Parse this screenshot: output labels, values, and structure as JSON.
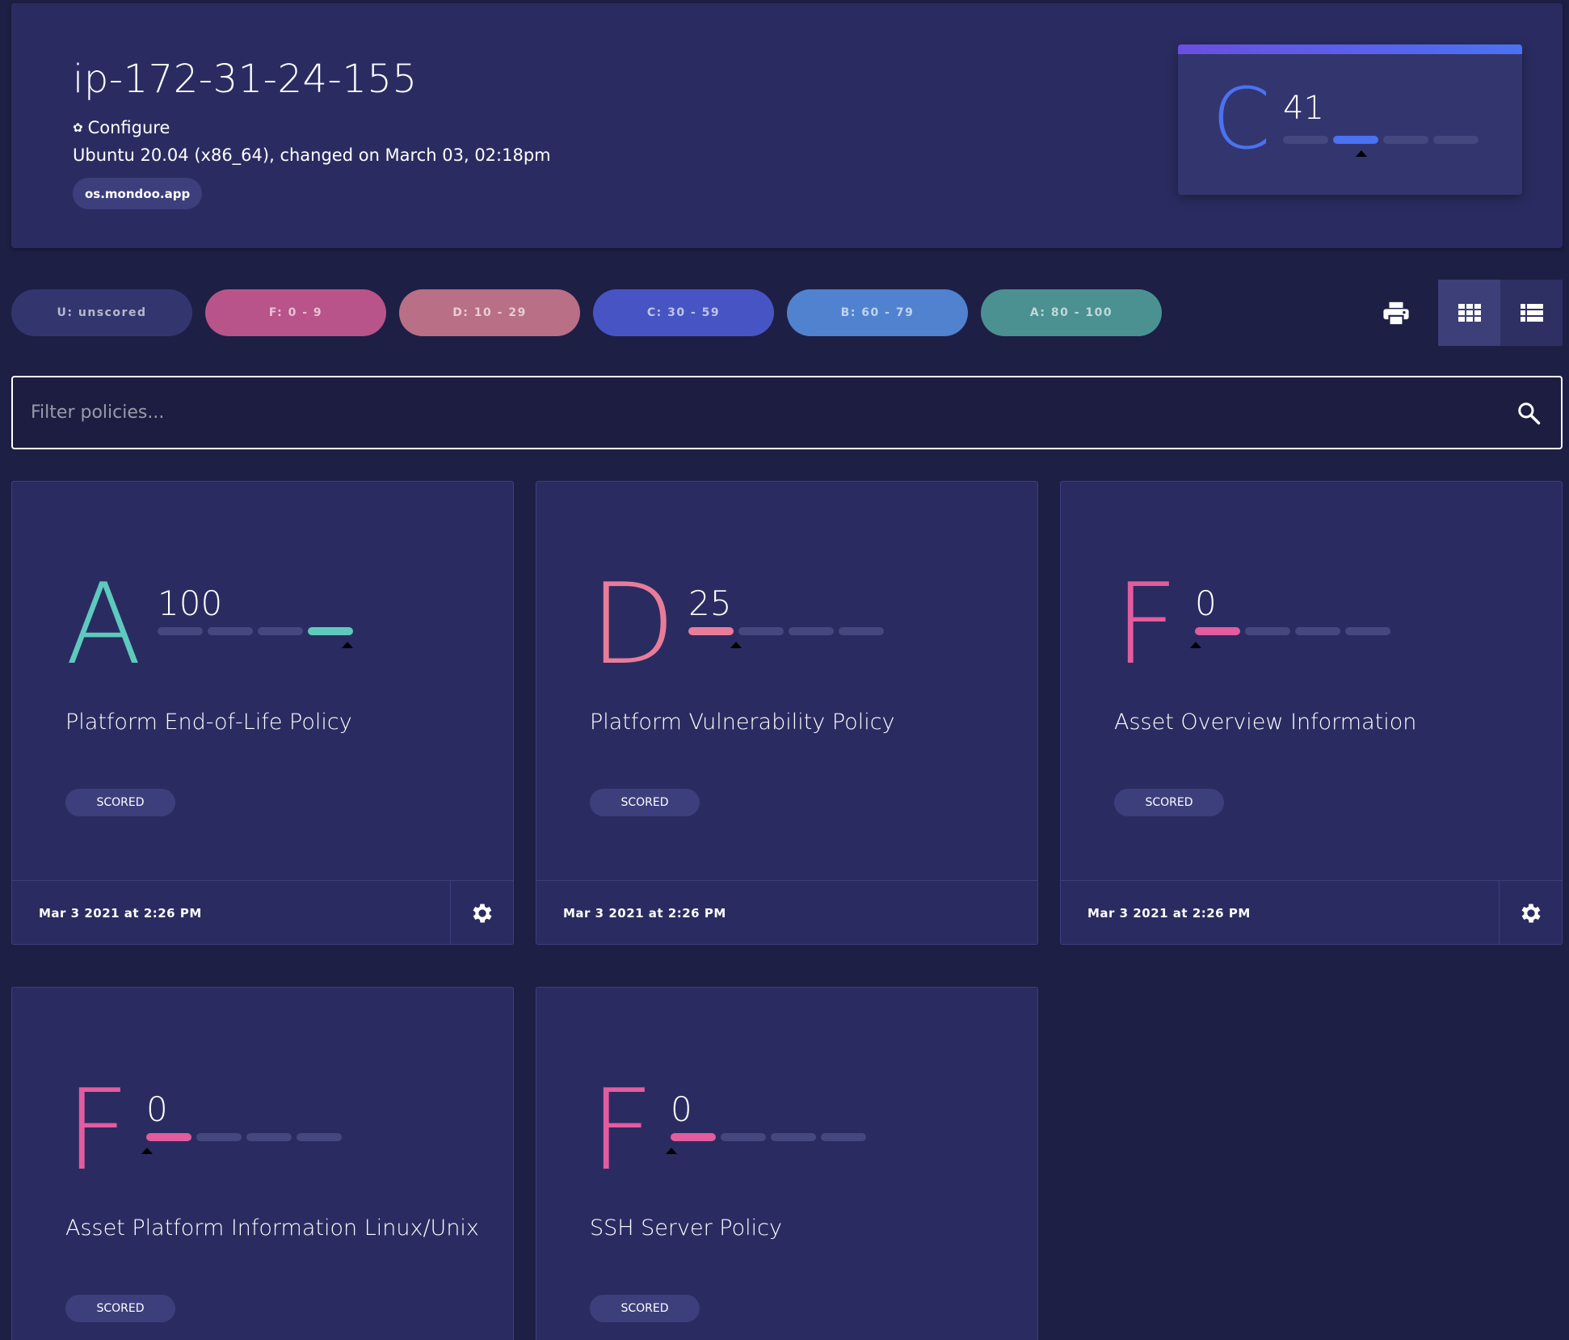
{
  "asset": {
    "title": "ip-172-31-24-155",
    "configure_label": "Configure",
    "os_line": "Ubuntu 20.04 (x86_64), changed on March 03, 02:18pm",
    "space_chip": "os.mondoo.app",
    "grade": "C",
    "score": "41",
    "score_value": 41
  },
  "filters": [
    {
      "label": "U: unscored"
    },
    {
      "label": "F: 0 - 9"
    },
    {
      "label": "D: 10 - 29"
    },
    {
      "label": "C: 30 - 59"
    },
    {
      "label": "B: 60 - 79"
    },
    {
      "label": "A: 80 - 100"
    }
  ],
  "search": {
    "placeholder": "Filter policies..."
  },
  "icons": {
    "configure": "gear-icon",
    "print": "printer-icon",
    "grid_view": "grid-view-icon",
    "list_view": "list-view-icon",
    "search": "search-icon",
    "card_settings": "gear-icon"
  },
  "colors": {
    "grade_a": "#5ec9bd",
    "grade_d": "#e87c99",
    "grade_f": "#e25c9e",
    "grade_c": "#4a72f2"
  },
  "policies": [
    {
      "grade": "A",
      "score": "100",
      "title": "Platform End-of-Life Policy",
      "chip": "SCORED",
      "date": "Mar 3 2021 at 2:26 PM"
    },
    {
      "grade": "D",
      "score": "25",
      "title": "Platform Vulnerability Policy",
      "chip": "SCORED",
      "date": "Mar 3 2021 at 2:26 PM"
    },
    {
      "grade": "F",
      "score": "0",
      "title": "Asset Overview Information",
      "chip": "SCORED",
      "date": "Mar 3 2021 at 2:26 PM"
    },
    {
      "grade": "F",
      "score": "0",
      "title": "Asset Platform Information Linux/Unix",
      "chip": "SCORED",
      "date": ""
    },
    {
      "grade": "F",
      "score": "0",
      "title": "SSH Server Policy",
      "chip": "SCORED",
      "date": ""
    }
  ]
}
